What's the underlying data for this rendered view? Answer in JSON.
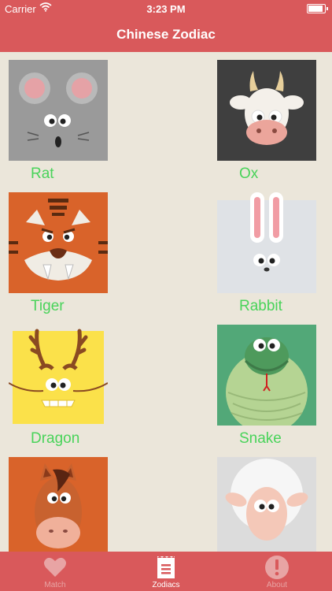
{
  "status_bar": {
    "carrier": "Carrier",
    "time": "3:23 PM"
  },
  "nav": {
    "title": "Chinese Zodiac"
  },
  "zodiacs": [
    {
      "label": "Rat",
      "icon": "rat-icon"
    },
    {
      "label": "Ox",
      "icon": "ox-icon"
    },
    {
      "label": "Tiger",
      "icon": "tiger-icon"
    },
    {
      "label": "Rabbit",
      "icon": "rabbit-icon"
    },
    {
      "label": "Dragon",
      "icon": "dragon-icon"
    },
    {
      "label": "Snake",
      "icon": "snake-icon"
    },
    {
      "label": "",
      "icon": "horse-icon"
    },
    {
      "label": "",
      "icon": "goat-icon"
    }
  ],
  "tabs": [
    {
      "label": "Match",
      "icon": "heart-icon",
      "active": false
    },
    {
      "label": "Zodiacs",
      "icon": "list-icon",
      "active": true
    },
    {
      "label": "About",
      "icon": "exclamation-icon",
      "active": false
    }
  ],
  "colors": {
    "bar": "#d9595b",
    "background": "#ebe6da",
    "label_green": "#49d35a"
  }
}
